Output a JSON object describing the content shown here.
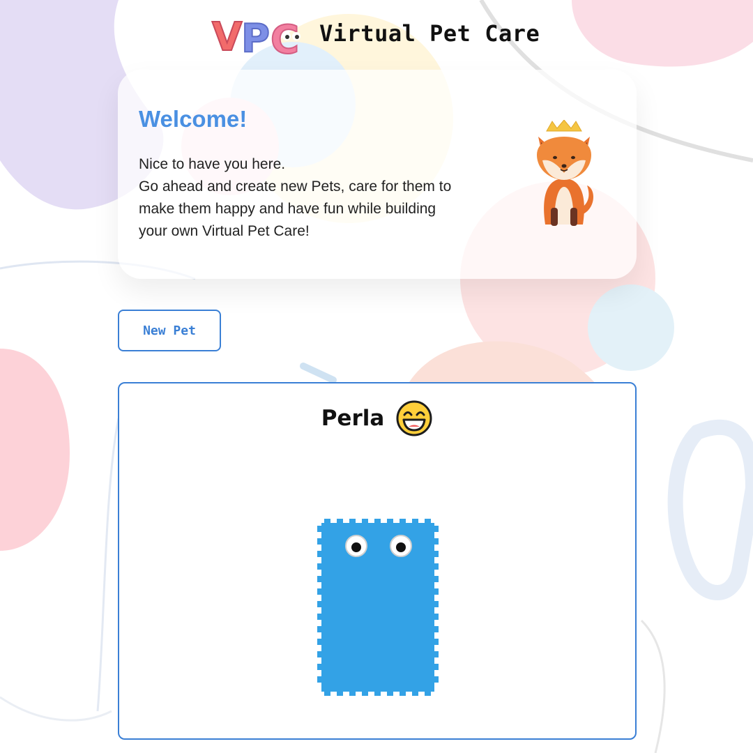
{
  "header": {
    "logo_text": "VPC",
    "app_title": "Virtual Pet Care"
  },
  "welcome": {
    "title": "Welcome!",
    "lines": [
      "Nice to have you here.",
      "Go ahead and create new Pets, care for them to",
      "make them happy and have fun while building",
      "your own Virtual Pet Care!"
    ],
    "mascot_icon": "fox-icon"
  },
  "actions": {
    "new_pet_label": "New Pet"
  },
  "pet": {
    "name": "Perla",
    "mood_icon": "grinning-face-icon",
    "color": "#33a2e6"
  },
  "theme": {
    "accent": "#3a7fd5",
    "welcome_title_color": "#4a90e2"
  }
}
